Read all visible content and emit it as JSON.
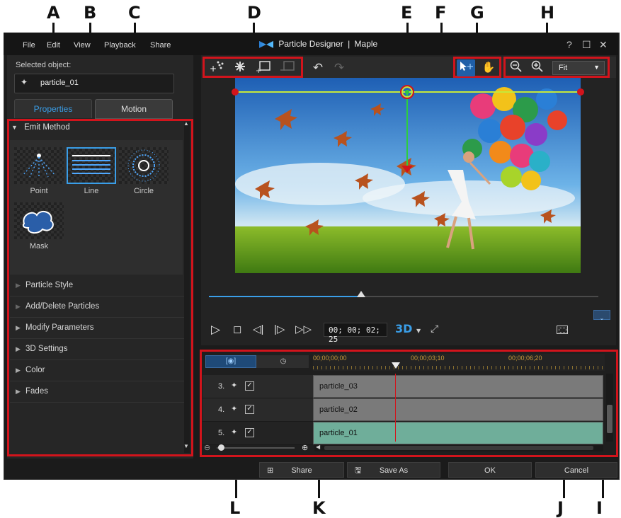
{
  "callouts": {
    "a": "A",
    "b": "B",
    "c": "C",
    "d": "D",
    "e": "E",
    "f": "F",
    "g": "G",
    "h": "H",
    "i": "I",
    "j": "J",
    "k": "K",
    "l": "L"
  },
  "window": {
    "app_name": "Particle Designer",
    "separator": "|",
    "project": "Maple",
    "help": "?",
    "maximize": "☐",
    "close": "✕"
  },
  "menu": [
    "File",
    "Edit",
    "View",
    "Playback",
    "Share"
  ],
  "selected": {
    "label": "Selected object:",
    "value": "particle_01"
  },
  "tabs": {
    "properties": "Properties",
    "motion": "Motion"
  },
  "emit": {
    "header": "Emit Method",
    "options": [
      "Point",
      "Line",
      "Circle",
      "Mask"
    ],
    "selected": "Line"
  },
  "sections": [
    "Particle Style",
    "Add/Delete Particles",
    "Modify Parameters",
    "3D Settings",
    "Color",
    "Fades"
  ],
  "toolbar": {
    "zoom_value": "Fit"
  },
  "playback": {
    "timecode": "00; 00; 02; 25",
    "mode": "3D",
    "progress": 0.39
  },
  "timeline": {
    "ruler": [
      "00;00;00;00",
      "00;00;03;10",
      "00;00;06;20"
    ],
    "tracks": [
      {
        "num": "3.",
        "name": "particle_03"
      },
      {
        "num": "4.",
        "name": "particle_02"
      },
      {
        "num": "5.",
        "name": "particle_01"
      }
    ]
  },
  "buttons": {
    "share": "Share",
    "save_as": "Save As",
    "ok": "OK",
    "cancel": "Cancel"
  },
  "colors": {
    "accent": "#3a9ee8",
    "highlight": "#d2141c",
    "guide": "#c6e83a"
  }
}
